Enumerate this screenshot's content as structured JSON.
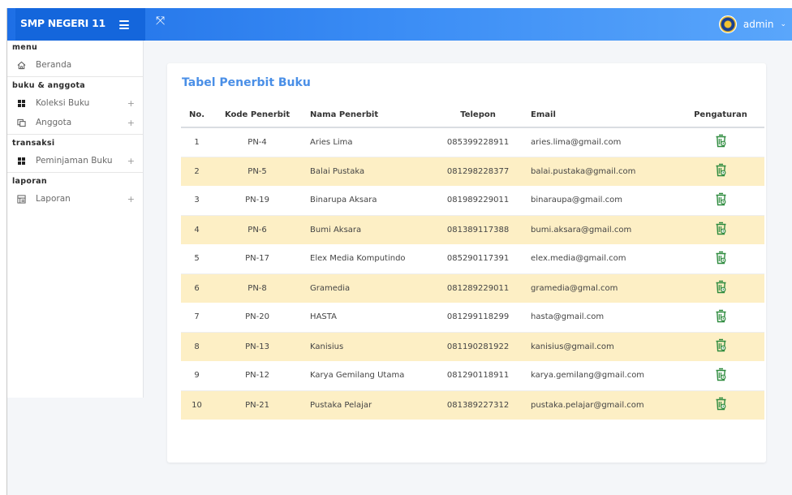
{
  "app": {
    "brand": "SMP NEGERI 11",
    "user": "admin"
  },
  "sidebar": {
    "sections": [
      {
        "title": "menu",
        "items": [
          {
            "label": "Beranda",
            "icon": "home-icon",
            "plus": false
          }
        ]
      },
      {
        "title": "buku & anggota",
        "items": [
          {
            "label": "Koleksi Buku",
            "icon": "grid-icon",
            "plus": true
          },
          {
            "label": "Anggota",
            "icon": "user-card-icon",
            "plus": true
          }
        ]
      },
      {
        "title": "transaksi",
        "items": [
          {
            "label": "Peminjaman Buku",
            "icon": "grid-icon",
            "plus": true
          }
        ]
      },
      {
        "title": "laporan",
        "items": [
          {
            "label": "Laporan",
            "icon": "report-icon",
            "plus": true
          }
        ]
      }
    ],
    "plus_symbol": "+"
  },
  "main": {
    "title": "Tabel Penerbit Buku",
    "headers": [
      "No.",
      "Kode Penerbit",
      "Nama Penerbit",
      "Telepon",
      "Email",
      "Pengaturan"
    ],
    "rows": [
      {
        "no": "1",
        "kode": "PN-4",
        "nama": "Aries Lima",
        "telepon": "085399228911",
        "email": "aries.lima@gmail.com"
      },
      {
        "no": "2",
        "kode": "PN-5",
        "nama": "Balai Pustaka",
        "telepon": "081298228377",
        "email": "balai.pustaka@gmail.com"
      },
      {
        "no": "3",
        "kode": "PN-19",
        "nama": "Binarupa Aksara",
        "telepon": "081989229011",
        "email": "binaraupa@gmail.com"
      },
      {
        "no": "4",
        "kode": "PN-6",
        "nama": "Bumi Aksara",
        "telepon": "081389117388",
        "email": "bumi.aksara@gmail.com"
      },
      {
        "no": "5",
        "kode": "PN-17",
        "nama": "Elex Media Komputindo",
        "telepon": "085290117391",
        "email": "elex.media@gmail.com"
      },
      {
        "no": "6",
        "kode": "PN-8",
        "nama": "Gramedia",
        "telepon": "081289229011",
        "email": "gramedia@gmal.com"
      },
      {
        "no": "7",
        "kode": "PN-20",
        "nama": "HASTA",
        "telepon": "081299118299",
        "email": "hasta@gmail.com"
      },
      {
        "no": "8",
        "kode": "PN-13",
        "nama": "Kanisius",
        "telepon": "081190281922",
        "email": "kanisius@gmail.com"
      },
      {
        "no": "9",
        "kode": "PN-12",
        "nama": "Karya Gemilang Utama",
        "telepon": "081290118911",
        "email": "karya.gemilang@gmail.com"
      },
      {
        "no": "10",
        "kode": "PN-21",
        "nama": "Pustaka Pelajar",
        "telepon": "081389227312",
        "email": "pustaka.pelajar@gmail.com"
      }
    ],
    "action_icon": "trash-restore-icon"
  },
  "colors": {
    "topbar": "#2a7ef0",
    "brand_bg": "#1466dc",
    "title": "#4a8fe7",
    "row_highlight": "#fdefc5",
    "trash_icon": "#2e8b3e"
  }
}
